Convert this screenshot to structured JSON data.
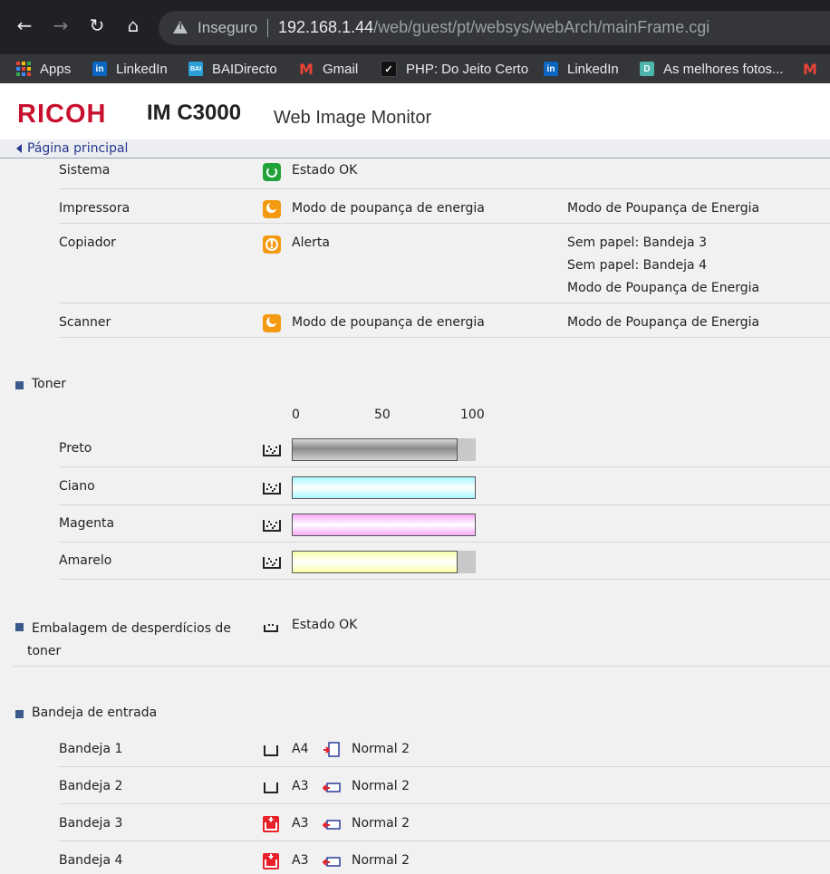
{
  "browser": {
    "security_label": "Inseguro",
    "url_host": "192.168.1.44",
    "url_path": "/web/guest/pt/websys/webArch/mainFrame.cgi",
    "bookmarks": [
      {
        "label": "Apps",
        "icon": "apps-grid-icon"
      },
      {
        "label": "LinkedIn",
        "icon": "linkedin-icon"
      },
      {
        "label": "BAIDirecto",
        "icon": "bai-icon"
      },
      {
        "label": "Gmail",
        "icon": "gmail-icon"
      },
      {
        "label": "PHP: Do Jeito Certo",
        "icon": "php-icon"
      },
      {
        "label": "LinkedIn",
        "icon": "linkedin-icon"
      },
      {
        "label": "As melhores fotos...",
        "icon": "d-icon"
      }
    ]
  },
  "header": {
    "brand": "RICOH",
    "model": "IM C3000",
    "app_name": "Web Image Monitor",
    "breadcrumb": "Página principal"
  },
  "status": [
    {
      "name": "Sistema",
      "state": "Estado OK",
      "icon": "status-ok-icon",
      "details": []
    },
    {
      "name": "Impressora",
      "state": "Modo de poupança de energia",
      "icon": "energy-save-icon",
      "details": [
        "Modo de Poupança de Energia"
      ]
    },
    {
      "name": "Copiador",
      "state": "Alerta",
      "icon": "alert-icon",
      "details": [
        "Sem papel: Bandeja 3",
        "Sem papel: Bandeja 4",
        "Modo de Poupança de Energia"
      ]
    },
    {
      "name": "Scanner",
      "state": "Modo de poupança de energia",
      "icon": "energy-save-icon",
      "details": [
        "Modo de Poupança de Energia"
      ]
    }
  ],
  "toner": {
    "title": "Toner",
    "scale": [
      "0",
      "50",
      "100"
    ],
    "items": [
      {
        "name": "Preto",
        "level": 90,
        "color": "#9a9a9a"
      },
      {
        "name": "Ciano",
        "level": 100,
        "color": "#a8f8ff"
      },
      {
        "name": "Magenta",
        "level": 100,
        "color": "#f8a8f8"
      },
      {
        "name": "Amarelo",
        "level": 90,
        "color": "#f8ffa8"
      }
    ]
  },
  "waste": {
    "title_line1": "Embalagem de desperdícios de",
    "title_line2": "toner",
    "state": "Estado OK"
  },
  "input_trays": {
    "title": "Bandeja de entrada",
    "items": [
      {
        "name": "Bandeja 1",
        "size": "A4",
        "paper": "Normal 2",
        "tray_state": "ok",
        "feed": "portrait"
      },
      {
        "name": "Bandeja 2",
        "size": "A3",
        "paper": "Normal 2",
        "tray_state": "ok",
        "feed": "landscape"
      },
      {
        "name": "Bandeja 3",
        "size": "A3",
        "paper": "Normal 2",
        "tray_state": "empty",
        "feed": "landscape"
      },
      {
        "name": "Bandeja 4",
        "size": "A3",
        "paper": "Normal 2",
        "tray_state": "empty",
        "feed": "landscape"
      }
    ]
  },
  "colors": {
    "ricoh_red": "#c8102e",
    "section_square": "#3a5a8c",
    "ok_green": "#22a33a",
    "warn_orange": "#f39a12"
  }
}
